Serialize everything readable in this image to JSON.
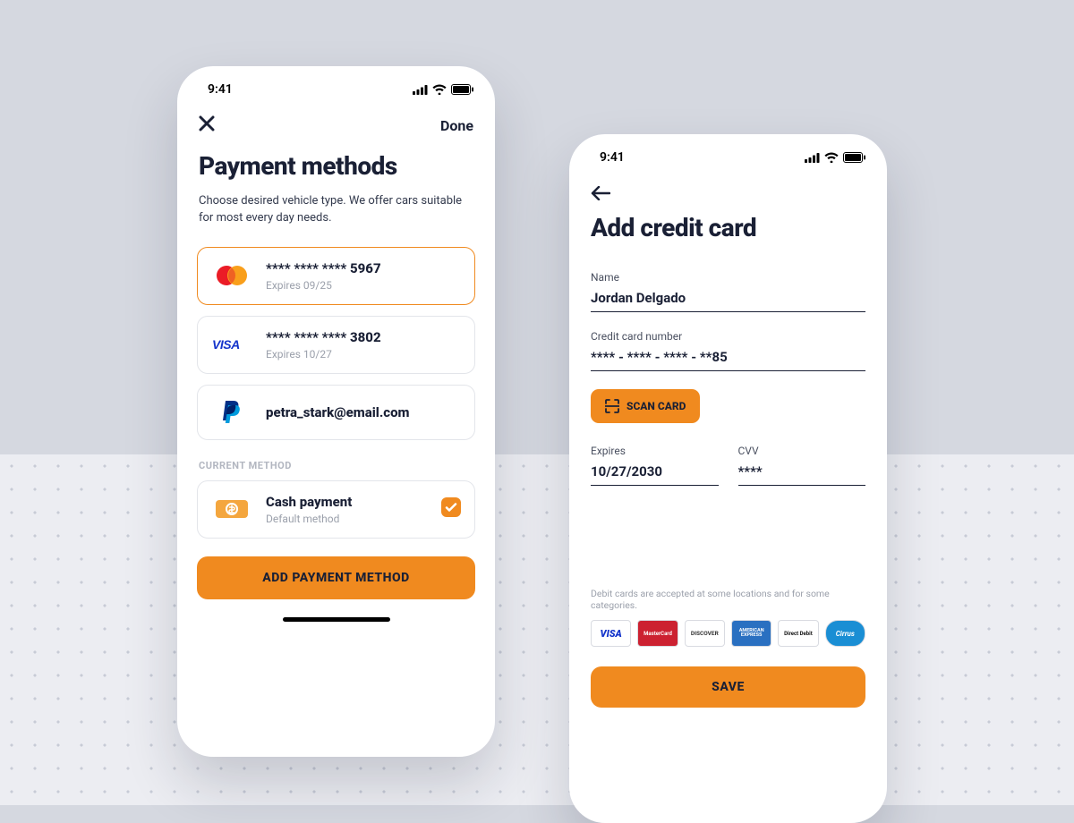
{
  "statusbar": {
    "time": "9:41"
  },
  "screen1": {
    "done_label": "Done",
    "title": "Payment methods",
    "subtitle": "Choose desired vehicle type. We offer cars suitable for most every day needs.",
    "methods": [
      {
        "brand": "mastercard",
        "number": "**** **** **** 5967",
        "expires": "Expires 09/25",
        "selected": true
      },
      {
        "brand": "visa",
        "number": "**** **** **** 3802",
        "expires": "Expires 10/27",
        "selected": false
      },
      {
        "brand": "paypal",
        "label": "petra_stark@email.com"
      }
    ],
    "current_label": "CURRENT METHOD",
    "current": {
      "title": "Cash payment",
      "sub": "Default method",
      "checked": true
    },
    "add_button": "ADD PAYMENT METHOD"
  },
  "screen2": {
    "title": "Add credit card",
    "fields": {
      "name_label": "Name",
      "name_value": "Jordan Delgado",
      "card_label": "Credit card number",
      "card_value": "**** - **** - **** - **85",
      "expires_label": "Expires",
      "expires_value": "10/27/2030",
      "cvv_label": "CVV",
      "cvv_value": "****"
    },
    "scan_button": "SCAN CARD",
    "disclaimer": "Debit cards are accepted at some locations and for some categories.",
    "brands": [
      "VISA",
      "MasterCard",
      "DISCOVER",
      "AMERICAN EXPRESS",
      "Direct Debit",
      "Cirrus"
    ],
    "save_button": "SAVE"
  },
  "colors": {
    "accent": "#f08a1f",
    "ink": "#1a2035"
  }
}
